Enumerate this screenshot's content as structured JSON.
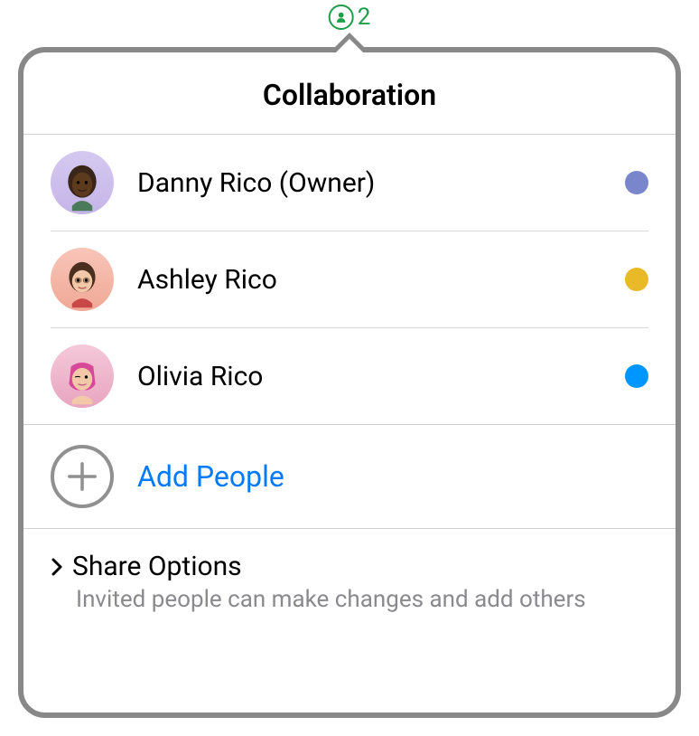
{
  "status": {
    "count": "2",
    "color": "#1e9e4a"
  },
  "popover": {
    "title": "Collaboration",
    "participants": [
      {
        "name": "Danny Rico (Owner)",
        "dotColor": "#7a86cc",
        "avatarClass": "avatar-1"
      },
      {
        "name": "Ashley Rico",
        "dotColor": "#e9b927",
        "avatarClass": "avatar-2"
      },
      {
        "name": "Olivia Rico",
        "dotColor": "#0096ff",
        "avatarClass": "avatar-3"
      }
    ],
    "addPeople": {
      "label": "Add People"
    },
    "shareOptions": {
      "title": "Share Options",
      "subtitle": "Invited people can make changes and add others"
    }
  }
}
